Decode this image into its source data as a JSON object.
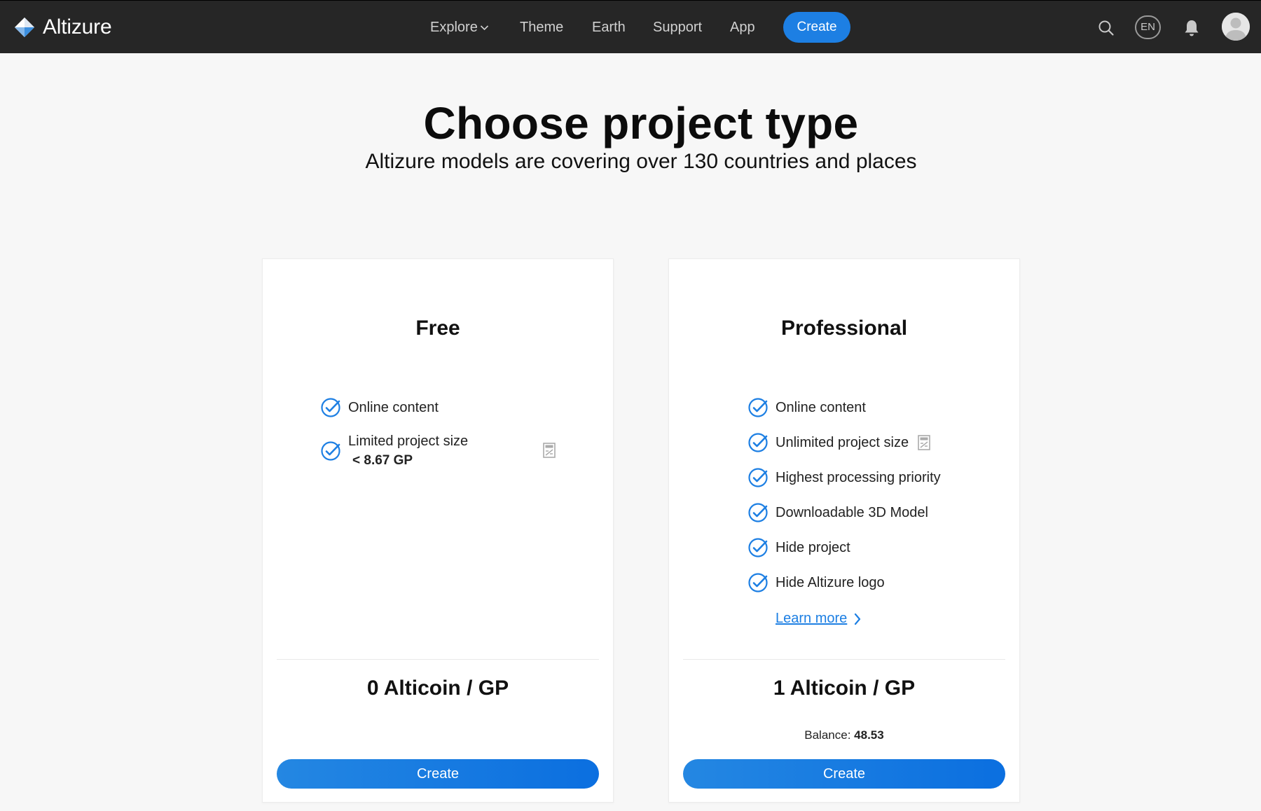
{
  "brand": {
    "name": "Altizure"
  },
  "nav": {
    "explore": "Explore",
    "theme": "Theme",
    "earth": "Earth",
    "support": "Support",
    "app": "App",
    "create": "Create",
    "language": "EN"
  },
  "header": {
    "title": "Choose project type",
    "subtitle": "Altizure models are covering over 130 countries and places"
  },
  "plans": {
    "free": {
      "title": "Free",
      "features": [
        "Online content",
        "Limited project size"
      ],
      "size_limit": "< 8.67 GP",
      "price": "0 Alticoin / GP",
      "button": "Create"
    },
    "pro": {
      "title": "Professional",
      "features": [
        "Online content",
        "Unlimited project size",
        "Highest processing priority",
        "Downloadable 3D Model",
        "Hide project",
        "Hide Altizure logo"
      ],
      "learn_more": "Learn more",
      "price": "1 Alticoin / GP",
      "balance_label": "Balance:",
      "balance_value": "48.53",
      "button": "Create"
    }
  },
  "colors": {
    "accent": "#1d7fe3",
    "topbar": "#262626",
    "background": "#f7f7f7"
  },
  "icons": [
    "altizure-logo-icon",
    "chevron-down-icon",
    "search-icon",
    "bell-icon",
    "user-avatar-icon",
    "check-circle-icon",
    "calculator-icon",
    "chevron-right-icon"
  ]
}
